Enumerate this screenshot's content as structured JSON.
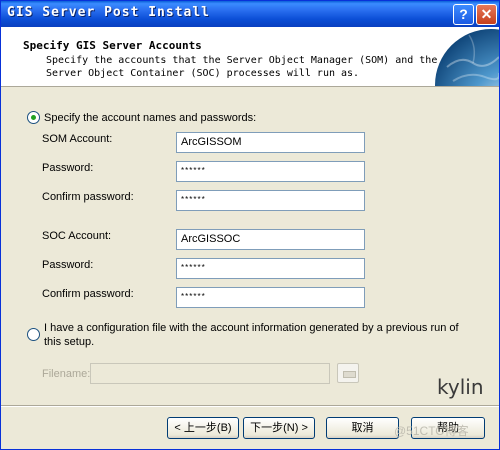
{
  "window": {
    "title": "GIS Server Post Install",
    "help_button": "?",
    "close_button": "✕"
  },
  "header": {
    "title": "Specify GIS Server Accounts",
    "description": "Specify the accounts that the Server Object Manager (SOM) and the Server Object Container (SOC) processes will run as."
  },
  "option_accounts": {
    "label": "Specify the account names and passwords:",
    "selected": true,
    "som_account_label": "SOM Account:",
    "som_account_value": "ArcGISSOM",
    "som_password_label": "Password:",
    "som_password_value": "******",
    "som_confirm_label": "Confirm password:",
    "som_confirm_value": "******",
    "soc_account_label": "SOC Account:",
    "soc_account_value": "ArcGISSOC",
    "soc_password_label": "Password:",
    "soc_password_value": "******",
    "soc_confirm_label": "Confirm password:",
    "soc_confirm_value": "******"
  },
  "option_config_file": {
    "label": "I have a configuration file with the account information generated by a previous run of this setup.",
    "selected": false,
    "filename_label": "Filename:",
    "filename_value": ""
  },
  "branding": {
    "text": "kylin"
  },
  "buttons": {
    "back": "< 上一步(B)",
    "next": "下一步(N) >",
    "cancel": "取消",
    "help": "帮助"
  },
  "watermark": "@51CTO博客"
}
